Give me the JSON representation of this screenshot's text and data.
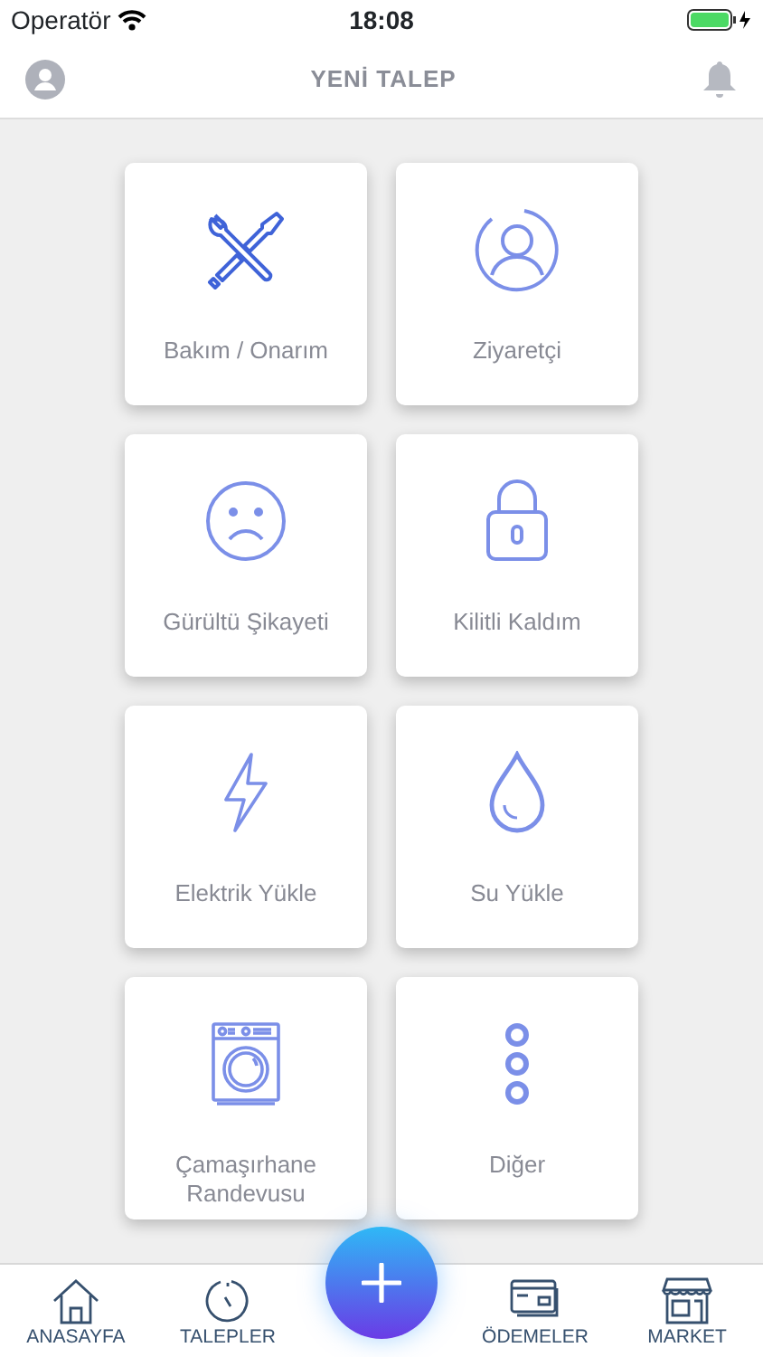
{
  "status_bar": {
    "carrier": "Operatör",
    "time": "18:08"
  },
  "header": {
    "title": "YENİ TALEP"
  },
  "tiles": [
    {
      "label": "Bakım / Onarım",
      "kind": "tools"
    },
    {
      "label": "Ziyaretçi",
      "kind": "visitor"
    },
    {
      "label": "Gürültü Şikayeti",
      "kind": "sad"
    },
    {
      "label": "Kilitli Kaldım",
      "kind": "lock"
    },
    {
      "label": "Elektrik Yükle",
      "kind": "bolt"
    },
    {
      "label": "Su Yükle",
      "kind": "drop"
    },
    {
      "label": "Çamaşırhane Randevusu",
      "kind": "washer"
    },
    {
      "label": "Diğer",
      "kind": "more"
    }
  ],
  "tab_bar": [
    {
      "label": "ANASAYFA",
      "kind": "home"
    },
    {
      "label": "TALEPLER",
      "kind": "dial"
    },
    {
      "label": "ÖDEMELER",
      "kind": "card"
    },
    {
      "label": "MARKET",
      "kind": "store"
    }
  ]
}
